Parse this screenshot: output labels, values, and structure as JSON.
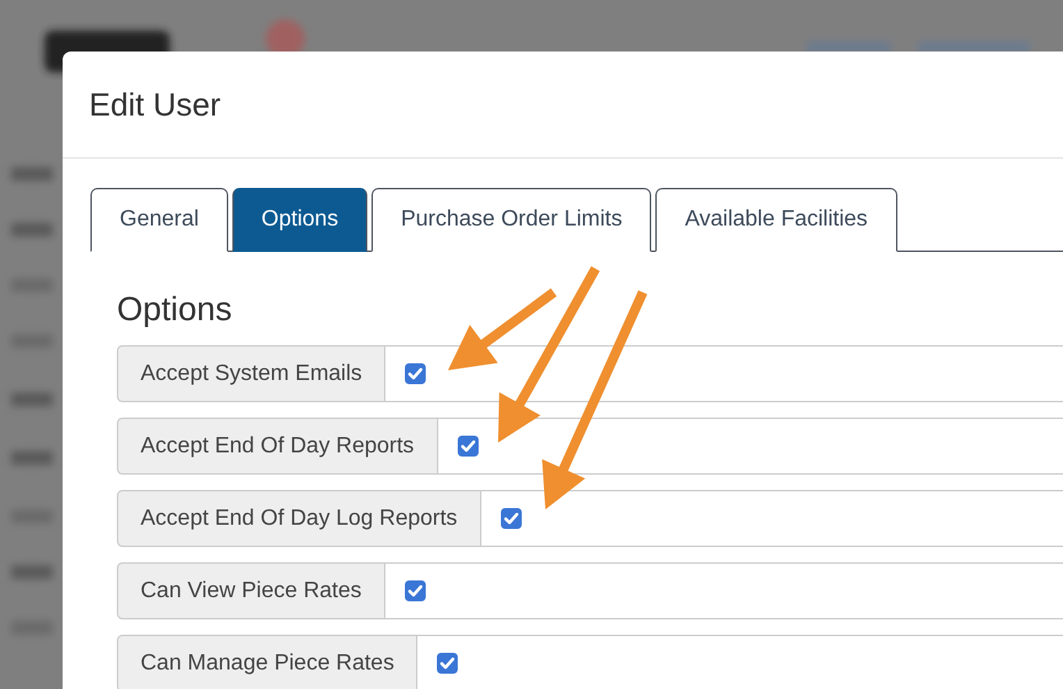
{
  "window": {
    "title": "Edit User"
  },
  "tabs": [
    {
      "label": "General",
      "selected": false
    },
    {
      "label": "Options",
      "selected": true
    },
    {
      "label": "Purchase Order Limits",
      "selected": false
    },
    {
      "label": "Available Facilities",
      "selected": false
    }
  ],
  "section": {
    "heading": "Options"
  },
  "options": [
    {
      "label": "Accept System Emails",
      "checked": true
    },
    {
      "label": "Accept End Of Day Reports",
      "checked": true
    },
    {
      "label": "Accept End Of Day Log Reports",
      "checked": true
    },
    {
      "label": "Can View Piece Rates",
      "checked": true
    },
    {
      "label": "Can Manage Piece Rates",
      "checked": true
    }
  ]
}
